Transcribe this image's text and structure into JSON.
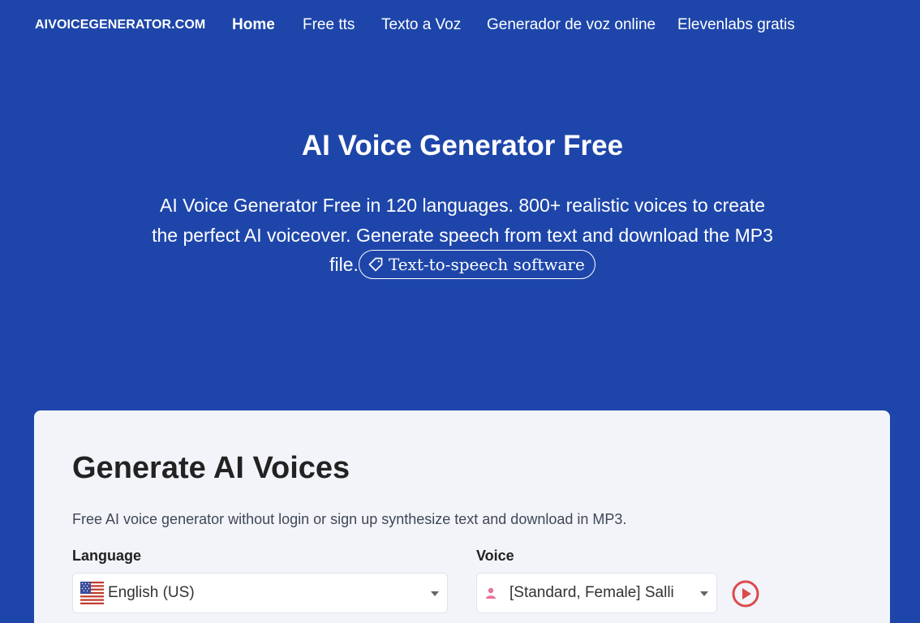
{
  "nav": {
    "brand": "AIVOICEGENERATOR.COM",
    "links": [
      "Home",
      "Free tts",
      "Texto a Voz",
      "Generador de voz online",
      "Elevenlabs gratis"
    ]
  },
  "hero": {
    "title": "AI Voice Generator Free",
    "description": "AI Voice Generator Free in 120 languages. 800+ realistic voices to create the perfect AI voiceover. Generate speech from text and download the MP3 file.",
    "tag": "Text-to-speech software"
  },
  "card": {
    "title": "Generate AI Voices",
    "subtitle": "Free AI voice generator without login or sign up synthesize text and download in MP3.",
    "language_label": "Language",
    "language_value": "English (US)",
    "voice_label": "Voice",
    "voice_value": "[Standard, Female] Salli"
  },
  "colors": {
    "background": "#1e46aa",
    "card": "#f2f4fa",
    "play_accent": "#dc4b4b",
    "person_icon": "#e8729a"
  },
  "icons": [
    "tag-icon",
    "us-flag-icon",
    "person-icon",
    "play-icon",
    "caret-down-icon"
  ]
}
